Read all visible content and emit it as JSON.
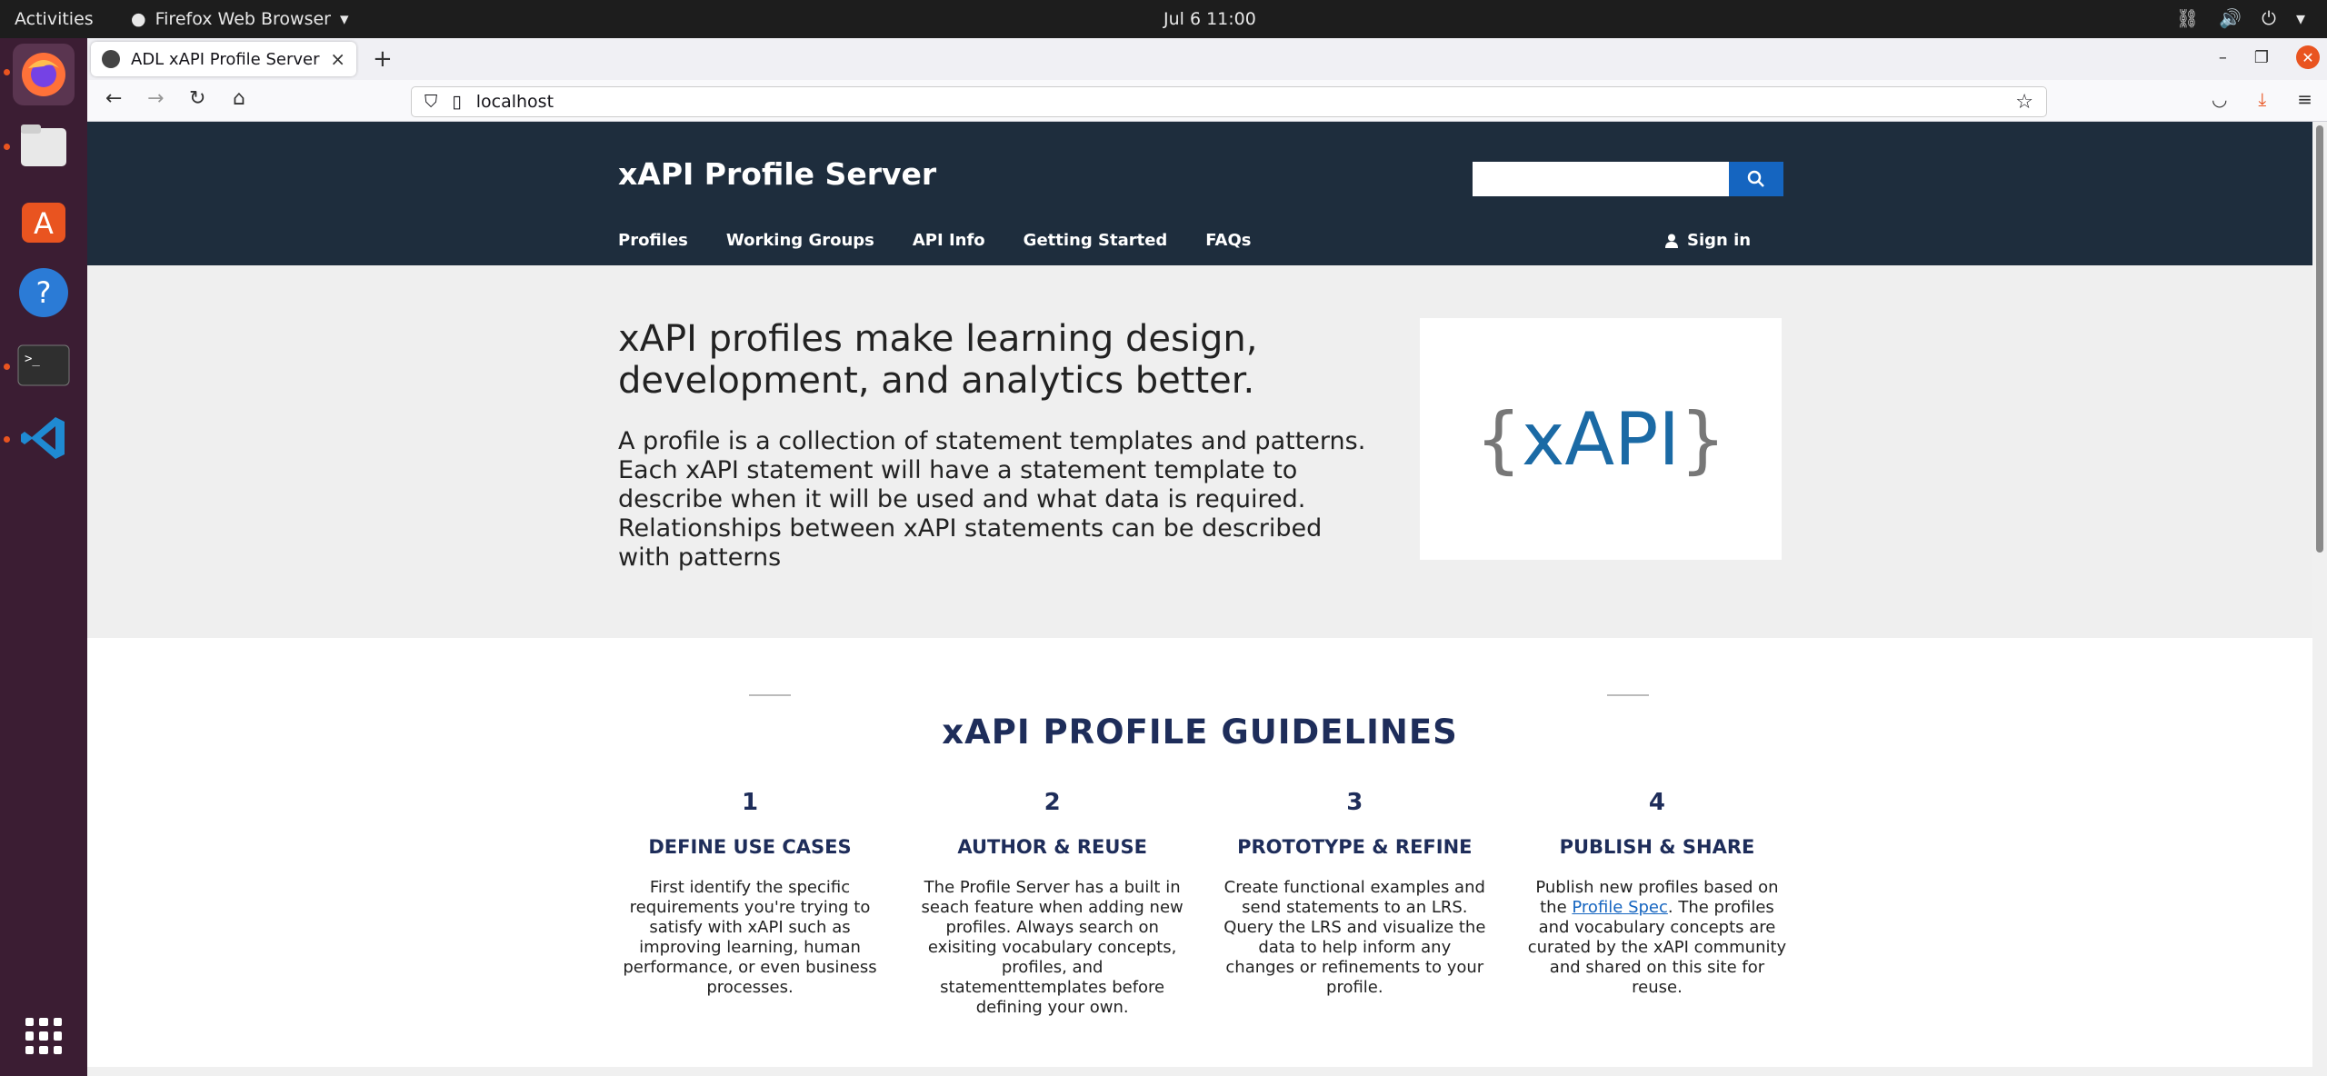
{
  "topbar": {
    "activities": "Activities",
    "app_name": "Firefox Web Browser",
    "clock": "Jul 6  11:00"
  },
  "dock": {
    "items": [
      "firefox-icon",
      "files-icon",
      "software-center-icon",
      "help-icon",
      "terminal-icon",
      "vscode-icon"
    ]
  },
  "browser": {
    "tab_title": "ADL xAPI Profile Server",
    "url": "localhost"
  },
  "site": {
    "brand": "xAPI Profile Server",
    "search_placeholder": "",
    "nav": [
      "Profiles",
      "Working Groups",
      "API Info",
      "Getting Started",
      "FAQs"
    ],
    "signin": "Sign in"
  },
  "hero": {
    "heading": "xAPI profiles make learning design, development, and analytics better.",
    "text": "A profile is a collection of statement templates and patterns. Each xAPI statement will have a statement template to describe when it will be used and what data is required. Relationships between xAPI statements can be described with patterns",
    "logo_open": "{",
    "logo_word": "xAPI",
    "logo_close": "}"
  },
  "guidelines": {
    "title": "xAPI PROFILE GUIDELINES",
    "steps": [
      {
        "num": "1",
        "head": "DEFINE USE CASES",
        "body": "First identify the specific requirements you're trying to satisfy with xAPI such as improving learning, human performance, or even business processes."
      },
      {
        "num": "2",
        "head": "AUTHOR & REUSE",
        "body": "The Profile Server has a built in seach feature when adding new profiles. Always search on exisiting vocabulary concepts, profiles, and statementtemplates before defining your own."
      },
      {
        "num": "3",
        "head": "PROTOTYPE & REFINE",
        "body": "Create functional examples and send statements to an LRS. Query the LRS and visualize the data to help inform any changes or refinements to your profile."
      },
      {
        "num": "4",
        "head": "PUBLISH & SHARE",
        "body_pre": "Publish new profiles based on the ",
        "body_link": "Profile Spec",
        "body_post": ". The profiles and vocabulary concepts are curated by the xAPI community and shared on this site for reuse."
      }
    ]
  },
  "colors": {
    "header_bg": "#1e2d3d",
    "accent": "#1565c0",
    "guideline_title": "#1e2d5a",
    "dock_bg": "#3b1d33",
    "ubuntu_orange": "#e95420"
  }
}
